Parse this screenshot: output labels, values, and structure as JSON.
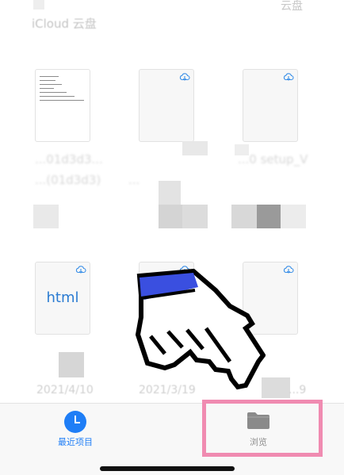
{
  "header": {
    "location_title": "iCloud 云盘",
    "top_right_text": "云盘"
  },
  "files": {
    "row1_names": [
      "...01d3d3...",
      "...",
      "...0 setup_V"
    ],
    "row1_sub_names": [
      "...(01d3d3)"
    ],
    "row2": [
      {
        "label": "html",
        "date": "2021/4/10"
      },
      {
        "label": "",
        "date": "2021/3/19"
      },
      {
        "label": "",
        "date": "...9"
      }
    ]
  },
  "tabbar": {
    "recent_label": "最近项目",
    "browse_label": "浏览"
  },
  "colors": {
    "accent": "#1f7ef6",
    "highlight": "#f08bb1",
    "html_text": "#2a7bd2"
  }
}
